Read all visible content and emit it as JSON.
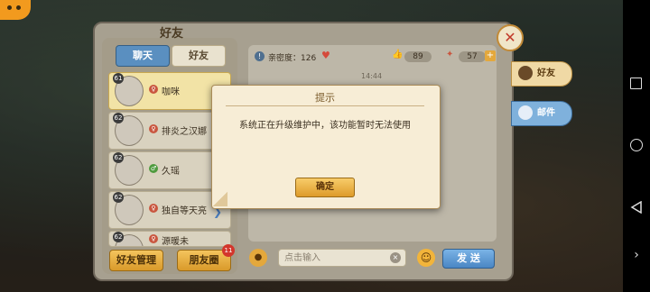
{
  "panel": {
    "title": "好友",
    "tabs": [
      {
        "label": "聊天",
        "active": true
      },
      {
        "label": "好友",
        "active": false
      }
    ]
  },
  "friends": [
    {
      "level": "61",
      "name": "咖咪",
      "gender": "female",
      "selected": true
    },
    {
      "level": "62",
      "name": "排炎之汉娜",
      "gender": "female",
      "selected": false
    },
    {
      "level": "62",
      "name": "久瑶",
      "gender": "male",
      "selected": false
    },
    {
      "level": "62",
      "name": "独自等天亮",
      "gender": "female",
      "selected": false
    },
    {
      "level": "62",
      "name": "源暖未",
      "gender": "female",
      "selected": false
    }
  ],
  "buttons": {
    "friend_manage": "好友管理",
    "moments": "朋友圈",
    "moments_badge": "11",
    "send": "发 送"
  },
  "chat": {
    "intimacy_label": "亲密度：126",
    "likes": "89",
    "gifts": "57",
    "timestamp": "14:44",
    "input_placeholder": "点击输入"
  },
  "side_tabs": {
    "friends": "好友",
    "mail": "邮件"
  },
  "modal": {
    "title": "提示",
    "message": "系统正在升级维护中，该功能暂时无法使用",
    "ok_label": "确定"
  },
  "colors": {
    "accent_blue": "#5a8fc0",
    "button_gold": "#f4c45d",
    "badge_red": "#d3362c"
  }
}
